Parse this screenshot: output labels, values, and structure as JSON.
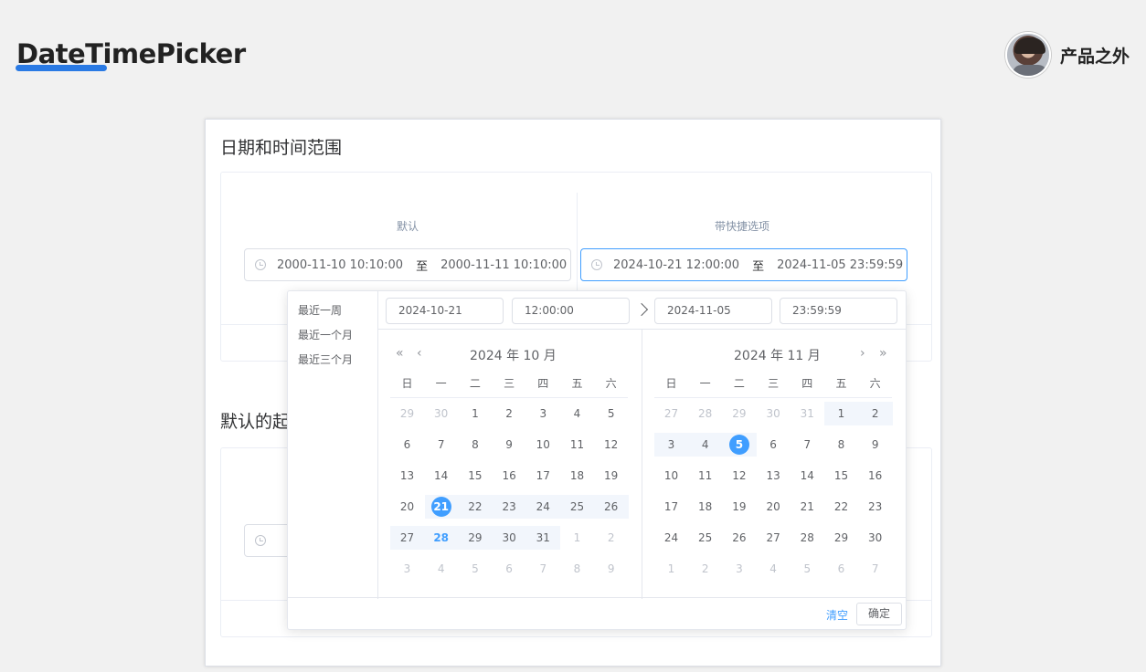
{
  "header": {
    "title": "DateTimePicker",
    "brand_name": "产品之外"
  },
  "section1": {
    "title": "日期和时间范围",
    "default_label": "默认",
    "shortcut_label": "带快捷选项",
    "default_range": {
      "start": "2000-11-10 10:10:00",
      "sep": "至",
      "end": "2000-11-11 10:10:00"
    },
    "shortcut_range": {
      "start": "2024-10-21 12:00:00",
      "sep": "至",
      "end": "2024-11-05 23:59:59"
    }
  },
  "section2": {
    "title_partial": "默认的起"
  },
  "picker": {
    "shortcuts": [
      "最近一周",
      "最近一个月",
      "最近三个月"
    ],
    "start_date": "2024-10-21",
    "start_time": "12:00:00",
    "end_date": "2024-11-05",
    "end_time": "23:59:59",
    "weekdays": [
      "日",
      "一",
      "二",
      "三",
      "四",
      "五",
      "六"
    ],
    "nav": {
      "prev_year": "«",
      "prev_month": "‹",
      "next_month": "›",
      "next_year": "»"
    },
    "left_title": "2024 年 10 月",
    "right_title": "2024 年 11 月",
    "left_days": [
      [
        "29",
        "30",
        "1",
        "2",
        "3",
        "4",
        "5"
      ],
      [
        "6",
        "7",
        "8",
        "9",
        "10",
        "11",
        "12"
      ],
      [
        "13",
        "14",
        "15",
        "16",
        "17",
        "18",
        "19"
      ],
      [
        "20",
        "21",
        "22",
        "23",
        "24",
        "25",
        "26"
      ],
      [
        "27",
        "28",
        "29",
        "30",
        "31",
        "1",
        "2"
      ],
      [
        "3",
        "4",
        "5",
        "6",
        "7",
        "8",
        "9"
      ]
    ],
    "right_days": [
      [
        "27",
        "28",
        "29",
        "30",
        "31",
        "1",
        "2"
      ],
      [
        "3",
        "4",
        "5",
        "6",
        "7",
        "8",
        "9"
      ],
      [
        "10",
        "11",
        "12",
        "13",
        "14",
        "15",
        "16"
      ],
      [
        "17",
        "18",
        "19",
        "20",
        "21",
        "22",
        "23"
      ],
      [
        "24",
        "25",
        "26",
        "27",
        "28",
        "29",
        "30"
      ],
      [
        "1",
        "2",
        "3",
        "4",
        "5",
        "6",
        "7"
      ]
    ],
    "clear_label": "清空",
    "confirm_label": "确定",
    "accent_color": "#409eff",
    "range_color": "#f2f6fc"
  }
}
